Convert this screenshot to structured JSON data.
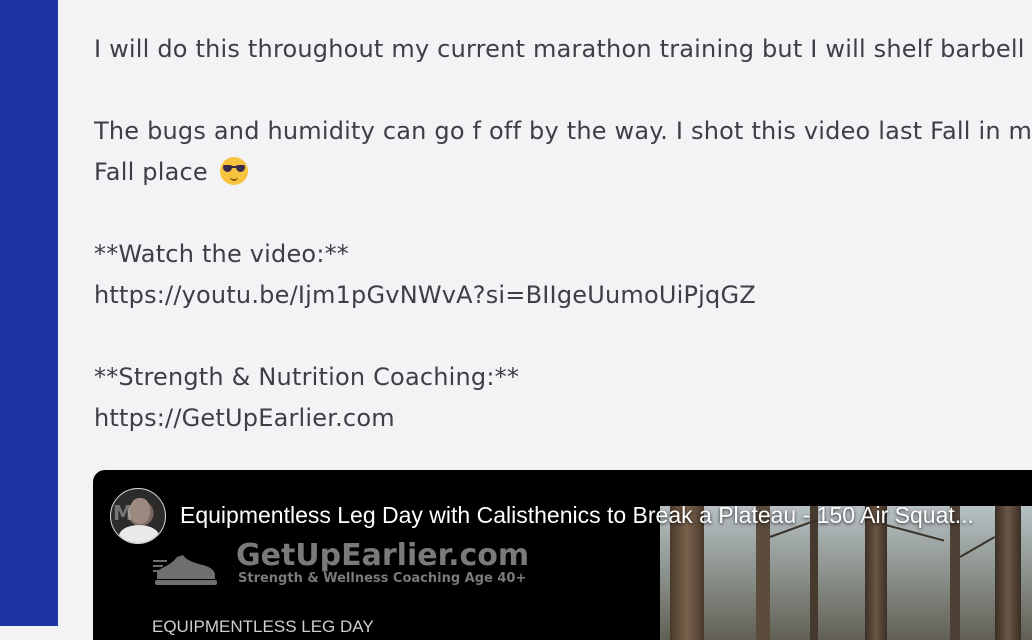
{
  "post": {
    "line1": "I will do this throughout my current marathon training but I will shelf barbell squats for now.",
    "line2": "The bugs and humidity can go f off by the way. I shot this video last Fall in my happy",
    "line3": "Fall place",
    "emoji": "smiling-face-with-sunglasses",
    "watch_heading": "**Watch the video:**",
    "watch_link": "https://youtu.be/Ijm1pGvNWvA?si=BIIgeUumoUiPjqGZ",
    "coaching_heading": "**Strength & Nutrition Coaching:**",
    "coaching_link": "https://GetUpEarlier.com"
  },
  "video": {
    "title": "Equipmentless Leg Day with Calisthenics to Break a Plateau - 150 Air Squat...",
    "avatar_monogram": "M",
    "brand_name": "GetUpEarlier.com",
    "brand_tagline": "Strength & Wellness Coaching Age 40+",
    "thumb_subtitle": "EQUIPMENTLESS LEG DAY"
  },
  "colors": {
    "left_rail": "#1c34a6",
    "background": "#f3f3f6",
    "text": "#3d3f45",
    "video_bg": "#000000"
  }
}
